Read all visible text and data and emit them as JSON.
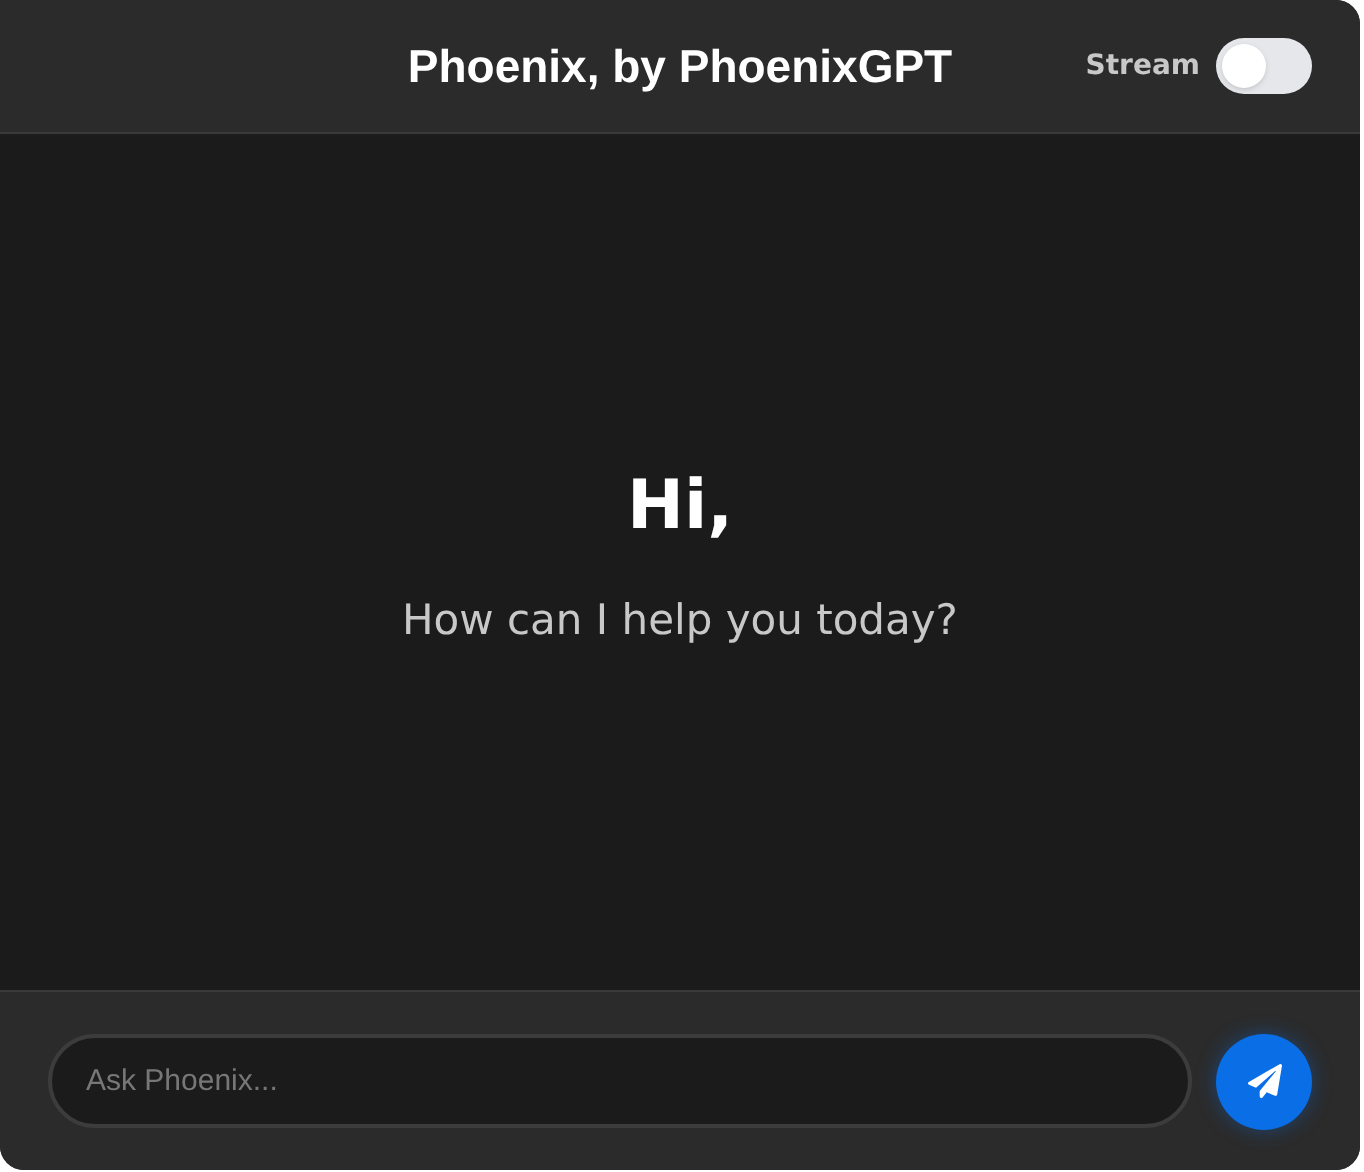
{
  "header": {
    "title": "Phoenix, by PhoenixGPT",
    "stream": {
      "label": "Stream",
      "on": false
    }
  },
  "welcome": {
    "heading": "Hi,",
    "subtitle": "How can I help you today?"
  },
  "composer": {
    "placeholder": "Ask Phoenix..."
  }
}
